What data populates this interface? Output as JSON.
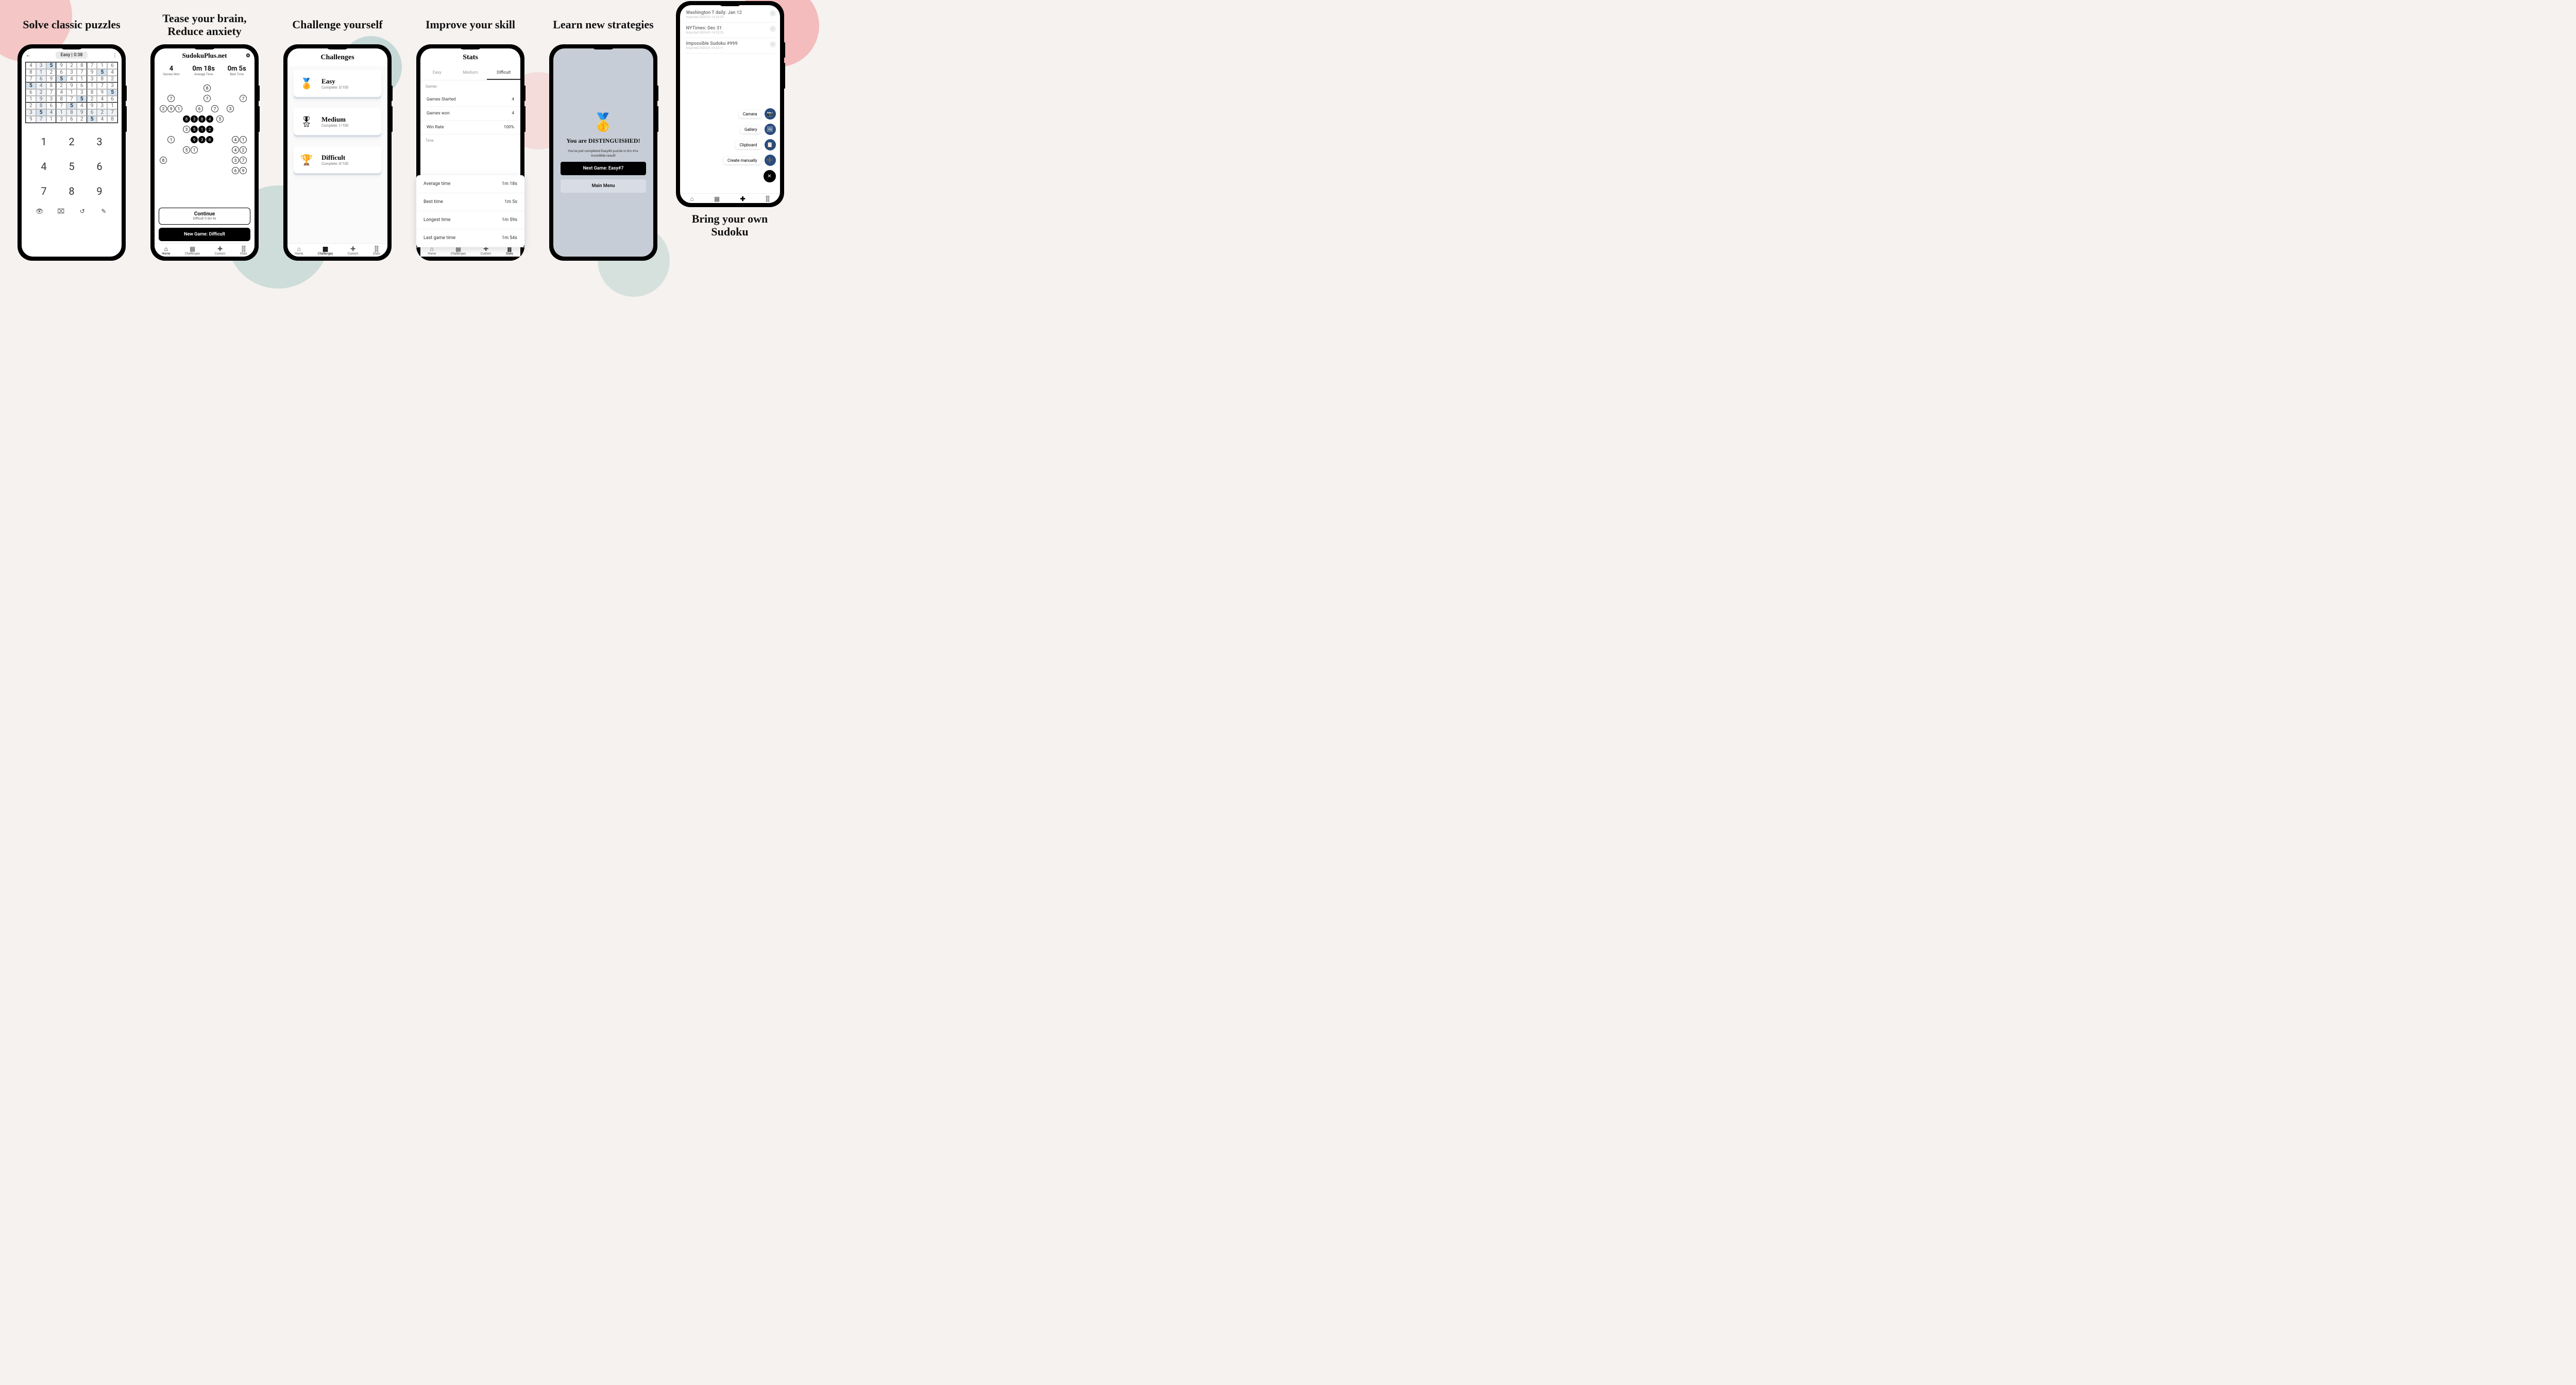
{
  "taglines": {
    "s1": "Solve classic puzzles",
    "s2": "Tease your brain,\nReduce anxiety",
    "s3": "Challenge yourself",
    "s4": "Improve your skill",
    "s5": "Learn new strategies",
    "s6": "Bring your own Sudoku"
  },
  "screen1": {
    "back_icon": "←",
    "chip": "Easy | 0:38",
    "more_icon": "⋮",
    "board_rows": [
      [
        4,
        3,
        5,
        9,
        2,
        8,
        7,
        1,
        6
      ],
      [
        8,
        1,
        2,
        6,
        3,
        7,
        9,
        5,
        4
      ],
      [
        7,
        6,
        9,
        5,
        4,
        1,
        3,
        8,
        2
      ],
      [
        5,
        4,
        8,
        2,
        9,
        6,
        1,
        7,
        3
      ],
      [
        6,
        2,
        7,
        4,
        1,
        3,
        8,
        9,
        5
      ],
      [
        1,
        9,
        3,
        8,
        7,
        5,
        2,
        4,
        6
      ],
      [
        2,
        8,
        6,
        7,
        5,
        4,
        9,
        3,
        1
      ],
      [
        3,
        5,
        4,
        1,
        8,
        9,
        6,
        2,
        7
      ],
      [
        9,
        7,
        1,
        3,
        6,
        2,
        5,
        4,
        8
      ]
    ],
    "numpad": [
      "1",
      "2",
      "3",
      "4",
      "5",
      "6",
      "7",
      "8",
      "9"
    ],
    "tools": {
      "hint": "👁",
      "erase": "⌧",
      "undo": "↺",
      "note": "✎"
    }
  },
  "screen2": {
    "title": "SudokuPlus.net",
    "gear": "⚙",
    "stats": [
      {
        "big": "4",
        "sm": "Games Won"
      },
      {
        "big": "0m 18s",
        "sm": "Average Time"
      },
      {
        "big": "0m 5s",
        "sm": "Best Time"
      }
    ],
    "continue_label": "Continue",
    "continue_sub": "Difficult ⏱ 0m 9s",
    "newgame_label": "New Game: Difficult",
    "nav": [
      {
        "ic": "⌂",
        "l": "Home"
      },
      {
        "ic": "▦",
        "l": "Challenges"
      },
      {
        "ic": "✚",
        "l": "Custom"
      },
      {
        "ic": "⫿⫿",
        "l": "Stats"
      }
    ]
  },
  "screen3": {
    "title": "Challenges",
    "cards": [
      {
        "ic": "🏅",
        "t": "Easy",
        "s": "Complete: 5/100"
      },
      {
        "ic": "🎖",
        "t": "Medium",
        "s": "Complete: 1/100"
      },
      {
        "ic": "🏆",
        "t": "Difficult",
        "s": "Complete: 0/100"
      }
    ]
  },
  "screen4": {
    "title": "Stats",
    "tabs": [
      "Easy",
      "Medium",
      "Difficult"
    ],
    "section_games": "Games",
    "rows_games": [
      {
        "l": "Games Started",
        "v": "4"
      },
      {
        "l": "Games won",
        "v": "4"
      },
      {
        "l": "Win Rate",
        "v": "100%"
      }
    ],
    "section_time": "Time",
    "overlay": [
      {
        "l": "Average time",
        "v": "1m 18s"
      },
      {
        "l": "Best time",
        "v": "1m 5s"
      },
      {
        "l": "Longest time",
        "v": "1m 59s"
      },
      {
        "l": "Last game time",
        "v": "1m 54s"
      }
    ]
  },
  "screen5": {
    "medal": "🥇",
    "heading": "You are DISTINGUISHED!",
    "body": "You've just completed Easy#6 puzzle in 0m 41s. Incredible result!",
    "next": "Next Game: Easy#7",
    "menu": "Main Menu"
  },
  "screen6": {
    "items": [
      {
        "t": "Washington T daily: Jan 12",
        "s": "Imported 2020-01-14 23:29"
      },
      {
        "t": "NYTimes: Dec 31",
        "s": "Imported 2020-01-14 23:25"
      },
      {
        "t": "Impossible Sudoku #999",
        "s": "Imported 2020-01-14 22:11"
      }
    ],
    "fabs": [
      {
        "l": "Camera",
        "ic": "📷"
      },
      {
        "l": "Gallery",
        "ic": "🖼"
      },
      {
        "l": "Clipboard",
        "ic": "📋"
      },
      {
        "l": "Create manually",
        "ic": "➕"
      }
    ],
    "close": "✕",
    "nav_icons": [
      "⌂",
      "▦",
      "✚",
      "⫿⫿"
    ]
  }
}
